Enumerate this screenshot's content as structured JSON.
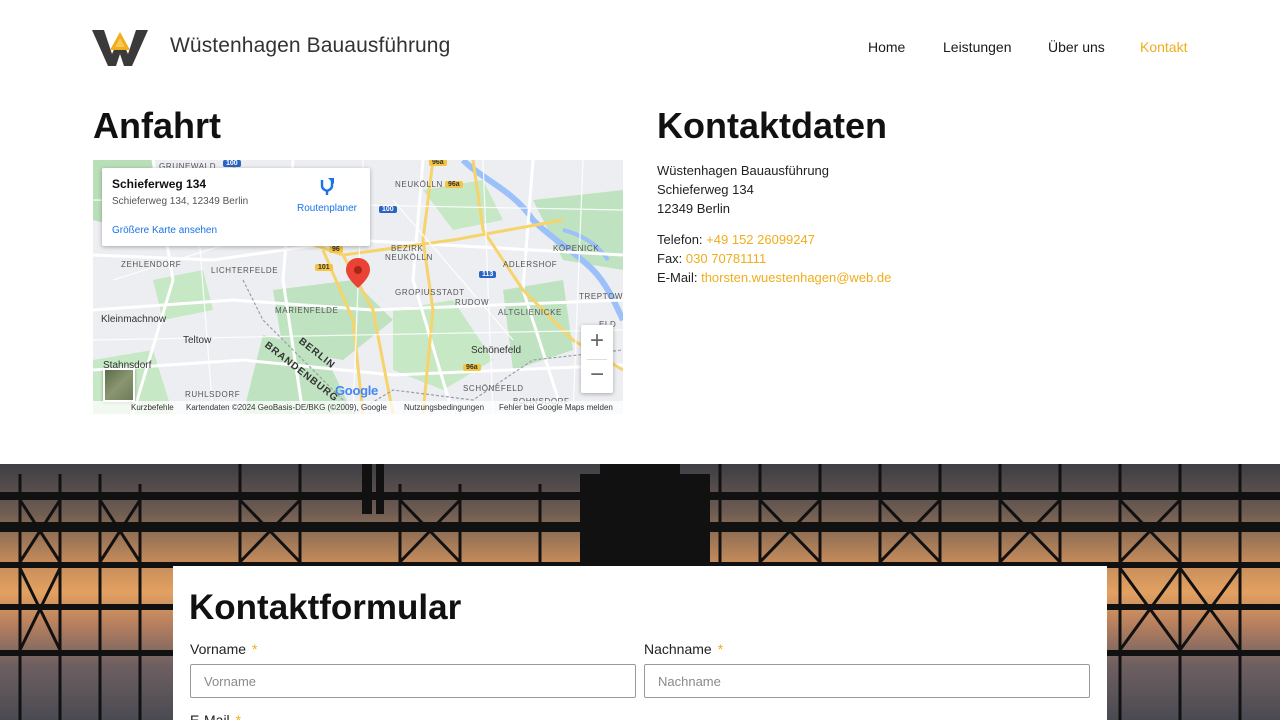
{
  "brand": {
    "name": "Wüstenhagen Bauausführung",
    "accent": "#f0ad1c"
  },
  "nav": {
    "items": [
      {
        "label": "Home"
      },
      {
        "label": "Leistungen"
      },
      {
        "label": "Über uns"
      },
      {
        "label": "Kontakt",
        "active": true
      }
    ]
  },
  "anfahrt": {
    "heading": "Anfahrt",
    "map": {
      "card_title": "Schieferweg 134",
      "card_address": "Schieferweg 134, 12349 Berlin",
      "route_label": "Routenplaner",
      "bigger_map_label": "Größere Karte ansehen",
      "zoom_in": "+",
      "zoom_out": "−",
      "google": "Google",
      "footer": {
        "shortcuts": "Kurzbefehle",
        "mapdata": "Kartendaten ©2024 GeoBasis-DE/BKG (©2009), Google",
        "terms": "Nutzungsbedingungen",
        "report": "Fehler bei Google Maps melden"
      },
      "labels": {
        "grunewald": "GRUNEWALD",
        "neukolln_top": "NEUKÖLLN",
        "zehlendorf": "ZEHLENDORF",
        "lichterfelde": "LICHTERFELDE",
        "bezirk": "BEZIRK",
        "neukolln": "NEUKÖLLN",
        "kopenick": "KÖPENICK",
        "adlershof": "ADLERSHOF",
        "gropiusstadt": "GROPIUSSTADT",
        "rudow": "RUDOW",
        "marienfelde": "MARIENFELDE",
        "altglienicke": "ALTGLIENICKE",
        "kleinmachnow": "Kleinmachnow",
        "teltow": "Teltow",
        "berlin": "BERLIN",
        "brandenburg": "BRANDENBURG",
        "schonefeld": "Schönefeld",
        "stahnsdorf": "Stahnsdorf",
        "ruhlsdorf": "RUHLSDORF",
        "schonefeld_caps": "SCHÖNEFELD",
        "bohnsdorf": "BOHNSDORF",
        "treptow": "TREPTOW-",
        "eld": "ELD"
      },
      "shields": {
        "s100a": "100",
        "s100b": "100",
        "s96a": "96a",
        "s96": "96",
        "s101": "101",
        "s113": "113",
        "s96a2": "96a",
        "s96a3": "96a"
      }
    }
  },
  "kontakt": {
    "heading": "Kontaktdaten",
    "company": "Wüstenhagen Bauausführung",
    "street": "Schieferweg 134",
    "city": "12349 Berlin",
    "phone_label": "Telefon:",
    "phone": "+49 152 26099247",
    "fax_label": "Fax:",
    "fax": "030 70781111",
    "email_label": "E-Mail:",
    "email": "thorsten.wuestenhagen@web.de"
  },
  "form": {
    "heading": "Kontaktformular",
    "required_mark": "*",
    "vorname_label": "Vorname",
    "vorname_placeholder": "Vorname",
    "nachname_label": "Nachname",
    "nachname_placeholder": "Nachname",
    "email_label": "E-Mail"
  }
}
